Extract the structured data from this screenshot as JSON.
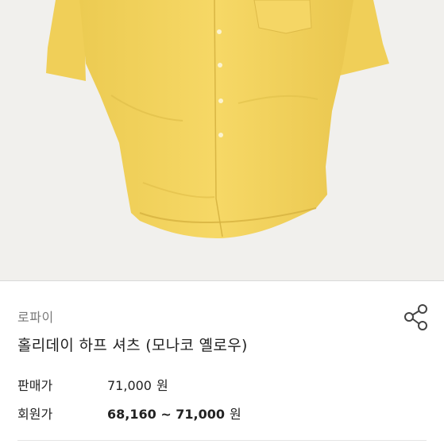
{
  "product": {
    "image_icon": "yellow-short-sleeve-shirt",
    "brand": "로파이",
    "title": "홀리데이 하프 셔츠 (모나코 옐로우)",
    "share_icon": "share-icon"
  },
  "prices": {
    "sale": {
      "label": "판매가",
      "value": "71,000",
      "unit": "원"
    },
    "member": {
      "label": "회원가",
      "value": "68,160 ~ 71,000",
      "unit": "원"
    }
  },
  "colors": {
    "shirt": "#f3d25d",
    "shirt_shadow": "#e3bf45",
    "background": "#f1f0ed",
    "text": "#222222",
    "muted": "#7a7a7a"
  }
}
